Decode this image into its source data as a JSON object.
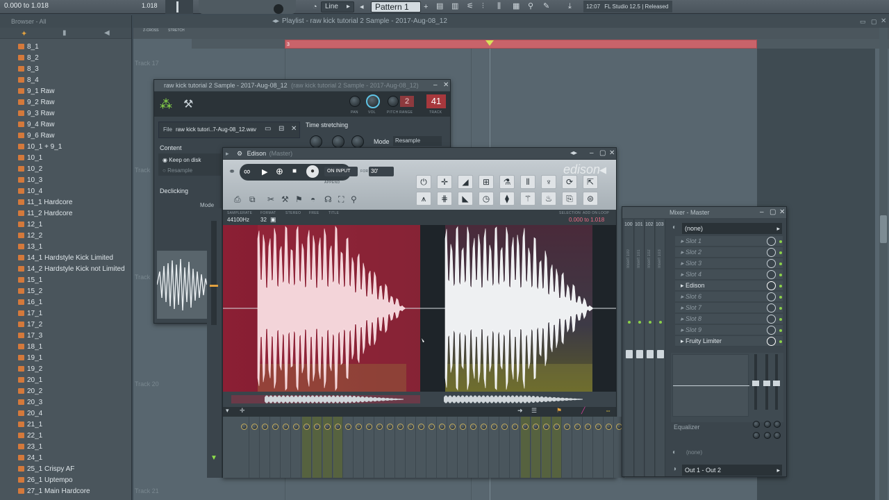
{
  "topbar": {
    "time_range": "0.000 to 1.018",
    "time_end": "1.018",
    "snap_mode": "Line",
    "pattern": "Pattern 1",
    "hint_time": "12:07",
    "hint_text": "FL Studio 12.5 | Released"
  },
  "browser": {
    "header": "Browser - All",
    "items": [
      "8_1",
      "8_2",
      "8_3",
      "8_4",
      "9_1 Raw",
      "9_2 Raw",
      "9_3 Raw",
      "9_4 Raw",
      "9_6 Raw",
      "10_1 + 9_1",
      "10_1",
      "10_2",
      "10_3",
      "10_4",
      "11_1 Hardcore",
      "11_2 Hardcore",
      "12_1",
      "12_2",
      "13_1",
      "14_1 Hardstyle Kick Limited",
      "14_2 Hardstyle Kick not Limited",
      "15_1",
      "15_2",
      "16_1",
      "17_1",
      "17_2",
      "17_3",
      "18_1",
      "19_1",
      "19_2",
      "20_1",
      "20_2",
      "20_3",
      "20_4",
      "21_1",
      "22_1",
      "23_1",
      "24_1",
      "25_1 Crispy AF",
      "26_1 Uptempo",
      "27_1 Main Hardcore"
    ]
  },
  "playlist": {
    "title": "Playlist - raw kick tutorial 2 Sample - 2017-Aug-08_12",
    "clip_label": "3",
    "tracks": [
      "Track 17",
      "Track",
      "Track",
      "Track 20",
      "Track 21"
    ],
    "toolbar_tags": [
      "Z-CROSS",
      "STRETCH"
    ]
  },
  "sampler": {
    "title": "raw kick tutorial 2 Sample - 2017-Aug-08_12",
    "title_sub": "(raw kick tutorial 2 Sample - 2017-Aug-08_12)",
    "knob_labels": [
      "PAN",
      "VOL",
      "PITCH",
      "RANGE",
      "TRACK"
    ],
    "range_value": "2",
    "track_value": "41",
    "file_label": "File",
    "file_name": "raw kick tutori..7-Aug-08_12.wav",
    "time_stretching": "Time stretching",
    "mode_label": "Mode",
    "mode_value": "Resample",
    "content": "Content",
    "keep_on_disk": "Keep on disk",
    "resample": "Resample",
    "declicking": "Declicking",
    "mode_short": "Mode"
  },
  "edison": {
    "title": "Edison",
    "title_sub": "(Master)",
    "logo": "edison",
    "on_input": "ON INPUT",
    "for_label": "FOR",
    "duration": "30'",
    "append": "APPEND",
    "info_labels": [
      "SAMPLERATE",
      "FORMAT",
      "STEREO",
      "FREE",
      "TITLE"
    ],
    "sample_rate": "44100Hz",
    "format": "32",
    "selection_labels": [
      "SELECTION",
      "ADD ON LOOP"
    ],
    "selection": "0.000 to 1.018"
  },
  "mixer": {
    "title": "Mixer - Master",
    "input": "(none)",
    "track_numbers": [
      "100",
      "101",
      "102",
      "103"
    ],
    "inserts": [
      "Insert 100",
      "Insert 101",
      "Insert 102",
      "Insert 103"
    ],
    "slots": [
      "Slot 1",
      "Slot 2",
      "Slot 3",
      "Slot 4",
      "Edison",
      "Slot 6",
      "Slot 7",
      "Slot 8",
      "Slot 9",
      "Fruity Limiter"
    ],
    "equalizer": "Equalizer",
    "send": "(none)",
    "output": "Out 1 - Out 2"
  }
}
